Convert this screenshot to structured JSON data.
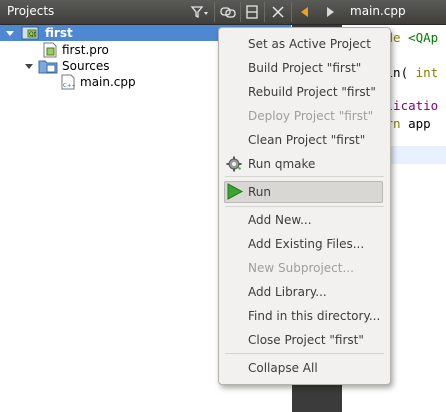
{
  "toolbar": {
    "panel_title": "Projects",
    "icons": [
      "filter-icon",
      "link-icon",
      "split-icon",
      "close-icon",
      "back-arrow-icon",
      "forward-arrow-icon"
    ],
    "file_tab": "main.cpp"
  },
  "tree": {
    "items": [
      {
        "label": "first",
        "level": 0,
        "expanded": true,
        "selected": true,
        "icon": "project-icon"
      },
      {
        "label": "first.pro",
        "level": 1,
        "icon": "pro-file-icon"
      },
      {
        "label": "Sources",
        "level": 1,
        "expanded": true,
        "icon": "sources-folder-icon"
      },
      {
        "label": "main.cpp",
        "level": 2,
        "icon": "cpp-file-icon"
      }
    ]
  },
  "editor": {
    "lines": [
      {
        "kw": "ude",
        "rest": " <QAp"
      },
      {
        "kw": "ain(",
        "rest": " int"
      },
      {
        "kw": "plicatio",
        "rest": ""
      },
      {
        "kw": "urn",
        "rest": " app"
      }
    ]
  },
  "context_menu": {
    "items": [
      {
        "label": "Set as Active Project",
        "enabled": true
      },
      {
        "label": "Build Project \"first\"",
        "enabled": true
      },
      {
        "label": "Rebuild Project \"first\"",
        "enabled": true
      },
      {
        "label": "Deploy Project \"first\"",
        "enabled": false
      },
      {
        "label": "Clean Project \"first\"",
        "enabled": true
      },
      {
        "label": "Run qmake",
        "enabled": true,
        "icon": "gear-icon"
      },
      {
        "label": "Run",
        "enabled": true,
        "icon": "play-icon",
        "highlighted": true
      },
      {
        "label": "Add New...",
        "enabled": true
      },
      {
        "label": "Add Existing Files...",
        "enabled": true
      },
      {
        "label": "New Subproject...",
        "enabled": false
      },
      {
        "label": "Add Library...",
        "enabled": true
      },
      {
        "label": "Find in this directory...",
        "enabled": true
      },
      {
        "label": "Close Project \"first\"",
        "enabled": true
      },
      {
        "label": "Collapse All",
        "enabled": true
      }
    ]
  },
  "colors": {
    "selection": "#4e88d2",
    "menu_background": "#f2f1f0",
    "run_icon": "#3aa52e",
    "back_arrow": "#f0a020"
  }
}
